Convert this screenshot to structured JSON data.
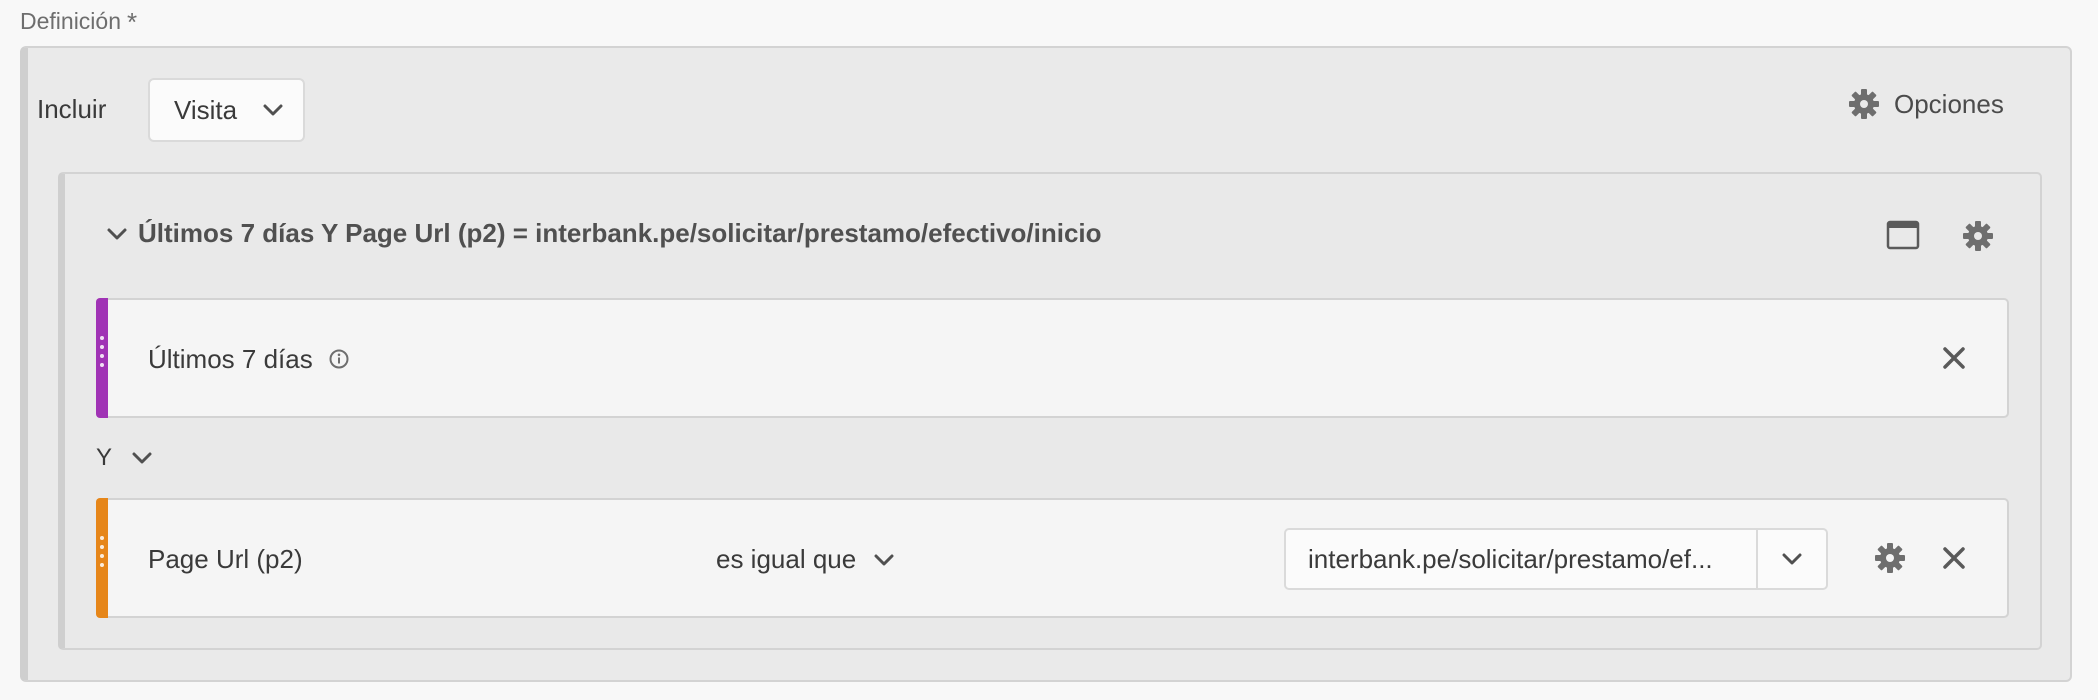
{
  "definition": {
    "label": "Definición",
    "required_marker": "*"
  },
  "include": {
    "label": "Incluir",
    "scope_value": "Visita"
  },
  "options": {
    "label": "Opciones",
    "icon": "gear-icon"
  },
  "container": {
    "title": "Últimos 7 días Y Page Url (p2) = interbank.pe/solicitar/prestamo/efectivo/inicio",
    "icons": [
      "chevron-down-icon",
      "window-icon",
      "gear-icon"
    ]
  },
  "rules": [
    {
      "name": "Últimos 7 días",
      "handle_color": "#a033b5",
      "icons": [
        "info-icon",
        "close-icon"
      ]
    },
    {
      "name": "Page Url (p2)",
      "handle_color": "#e68619",
      "operator": "es igual que",
      "value": "interbank.pe/solicitar/prestamo/ef...",
      "icons": [
        "chevron-down-icon",
        "gear-icon",
        "close-icon"
      ]
    }
  ],
  "logical_operator": {
    "label": "Y"
  },
  "colors": {
    "panel_bg": "#eaeaea",
    "card_bg": "#f5f5f5",
    "text": "#3a3a3a",
    "icon": "#6e6e6e"
  }
}
